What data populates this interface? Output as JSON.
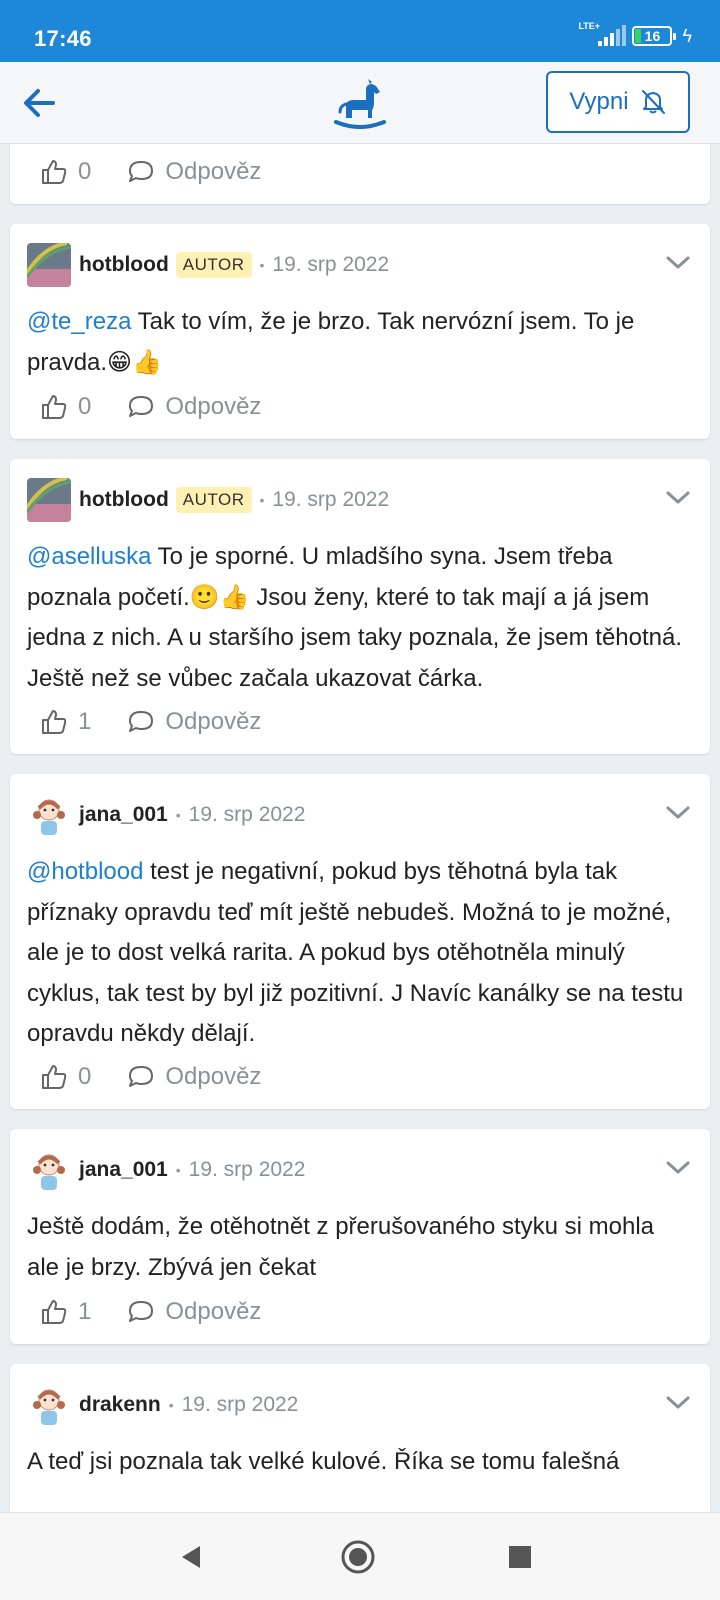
{
  "status_bar": {
    "time": "17:46",
    "network": "LTE+",
    "battery": "16"
  },
  "app_bar": {
    "back_icon": "arrow-left-icon",
    "logo_icon": "rocking-horse-icon",
    "mute_label": "Vypni",
    "mute_icon": "bell-off-icon",
    "accent_color": "#1c6fbf"
  },
  "ui": {
    "reply_label": "Odpověz",
    "autor_badge": "AUTOR"
  },
  "cards": [
    {
      "likes": "0"
    },
    {
      "author": "hotblood",
      "badge": "AUTOR",
      "date": "19. srp 2022",
      "mention": "@te_reza",
      "text": " Tak to vím, že je brzo. Tak nervózní jsem. To je pravda.😁👍",
      "likes": "0"
    },
    {
      "author": "hotblood",
      "badge": "AUTOR",
      "date": "19. srp 2022",
      "mention": "@aselluska",
      "text": " To je sporné. U mladšího syna. Jsem třeba poznala početí.🙂👍 Jsou ženy, které to tak mají a já jsem jedna z nich. A u staršího jsem taky poznala, že jsem těhotná. Ještě než se vůbec začala ukazovat čárka.",
      "likes": "1"
    },
    {
      "author": "jana_001",
      "date": "19. srp 2022",
      "mention": "@hotblood",
      "text": " test je negativní, pokud bys těhotná byla tak příznaky opravdu teď mít ještě nebudeš. Možná to je možné, ale je to dost velká rarita. A pokud bys otěhotněla minulý cyklus, tak test by byl již pozitivní. J Navíc kanálky se na testu opravdu někdy dělají.",
      "likes": "0"
    },
    {
      "author": "jana_001",
      "date": "19. srp 2022",
      "mention": "",
      "text": "Ještě dodám, že otěhotnět z přerušovaného styku si mohla ale je brzy. Zbývá jen čekat",
      "likes": "1"
    },
    {
      "author": "drakenn",
      "date": "19. srp 2022",
      "mention": "",
      "text": "A teď jsi poznala tak velké kulové. Říka se tomu falešná"
    }
  ],
  "nav_bar": {
    "back": "triangle-back-icon",
    "home": "circle-home-icon",
    "recents": "square-recents-icon"
  }
}
